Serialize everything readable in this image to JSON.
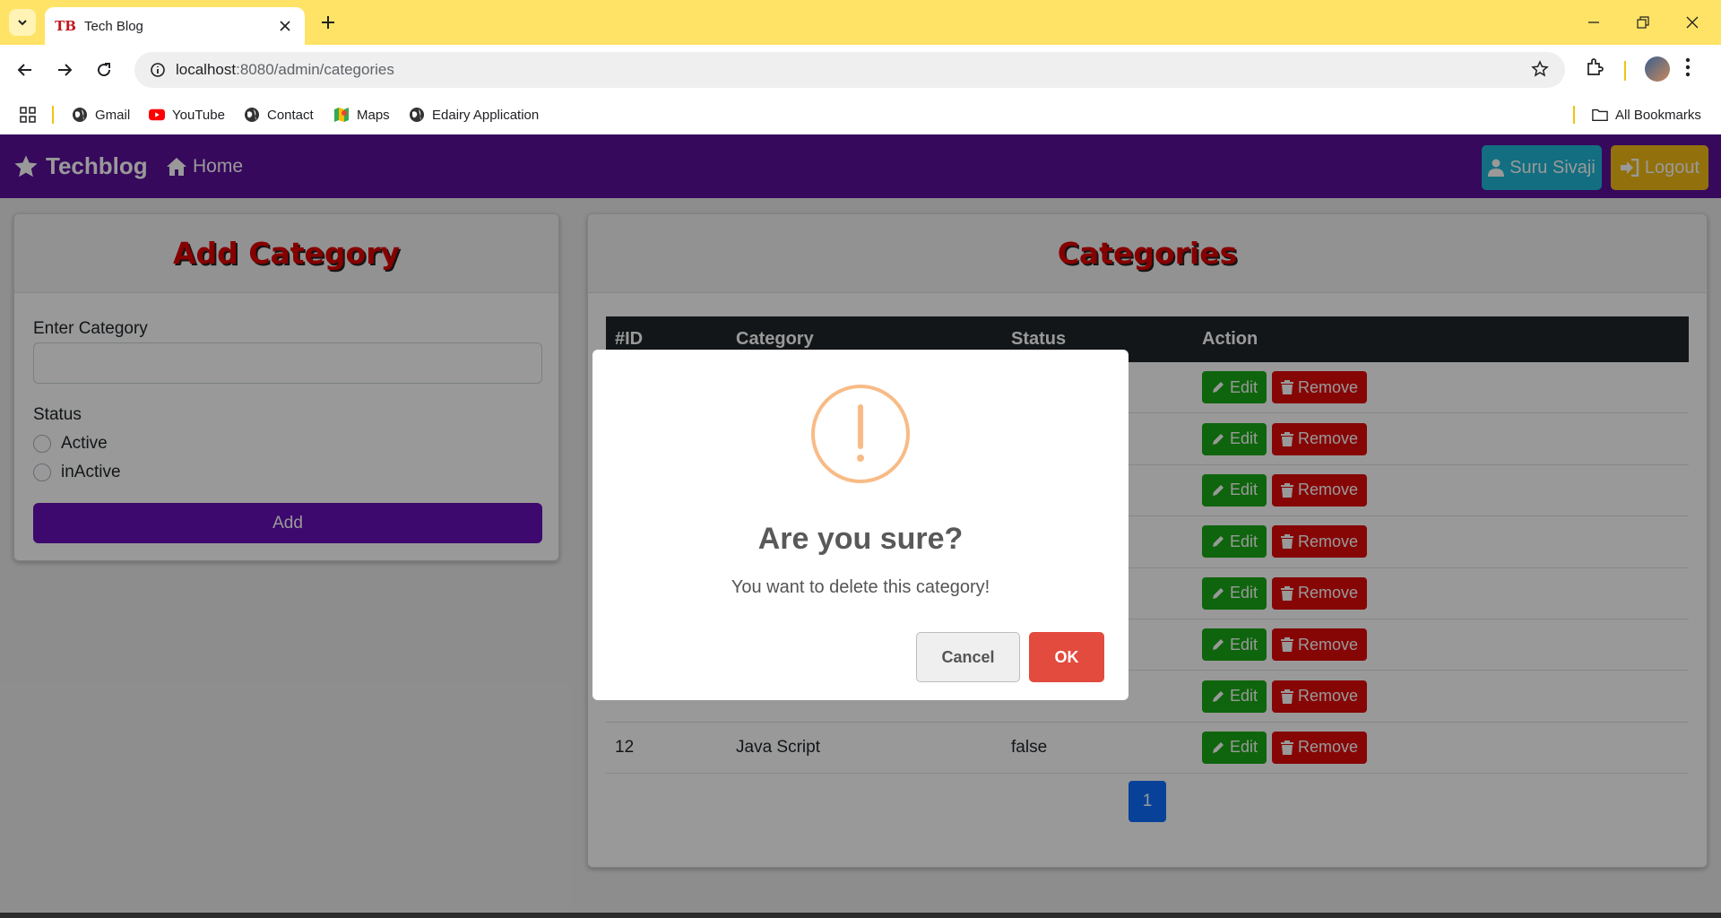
{
  "browser": {
    "tab_title": "Tech Blog",
    "tab_favicon_text": "TB",
    "url_host": "localhost",
    "url_path": ":8080/admin/categories",
    "bookmarks": [
      {
        "label": "Gmail",
        "icon": "globe-icon"
      },
      {
        "label": "YouTube",
        "icon": "youtube-icon"
      },
      {
        "label": "Contact",
        "icon": "globe-icon"
      },
      {
        "label": "Maps",
        "icon": "maps-icon"
      },
      {
        "label": "Edairy Application",
        "icon": "globe-icon"
      }
    ],
    "all_bookmarks": "All Bookmarks",
    "tabbar_color": "#ffe366"
  },
  "navbar": {
    "brand": "Techblog",
    "home": "Home",
    "user": "Suru Sivaji",
    "logout": "Logout",
    "color": "#5a0f9c"
  },
  "add_category": {
    "title": "Add Category",
    "input_label": "Enter Category",
    "input_value": "",
    "status_label": "Status",
    "options": [
      "Active",
      "inActive"
    ],
    "add_button": "Add"
  },
  "categories": {
    "title": "Categories",
    "columns": [
      "#ID",
      "Category",
      "Status",
      "Action"
    ],
    "rows": [
      {
        "id": "",
        "category": "",
        "status": ""
      },
      {
        "id": "",
        "category": "",
        "status": ""
      },
      {
        "id": "",
        "category": "",
        "status": ""
      },
      {
        "id": "",
        "category": "",
        "status": ""
      },
      {
        "id": "",
        "category": "",
        "status": ""
      },
      {
        "id": "",
        "category": "",
        "status": ""
      },
      {
        "id": "",
        "category": "",
        "status": ""
      },
      {
        "id": "12",
        "category": "Java Script",
        "status": "false"
      }
    ],
    "edit_label": "Edit",
    "remove_label": "Remove",
    "page": "1"
  },
  "dialog": {
    "title": "Are you sure?",
    "text": "You want to delete this category!",
    "cancel": "Cancel",
    "ok": "OK"
  }
}
